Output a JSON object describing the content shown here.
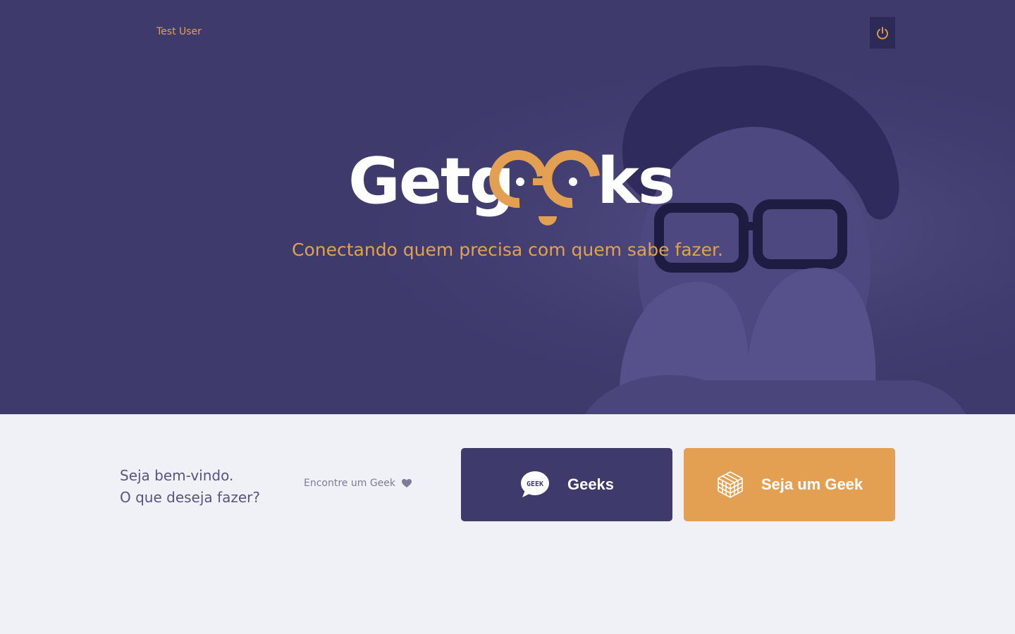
{
  "header": {
    "user_name": "Test User",
    "logout_icon": "power-icon"
  },
  "hero": {
    "logo_text_part1": "Getg",
    "logo_text_part2": "ks",
    "tagline": "Conectando quem precisa com quem sabe fazer."
  },
  "welcome": {
    "line1": "Seja bem-vindo.",
    "line2": "O que deseja fazer?"
  },
  "find_geek": {
    "label": "Encontre um Geek",
    "icon": "heart-icon"
  },
  "cards": {
    "geeks": {
      "label": "Geeks",
      "icon": "geek-speech-bubble-icon",
      "badge": "GEEK"
    },
    "seja": {
      "label": "Seja um Geek",
      "icon": "cube-icon"
    }
  },
  "colors": {
    "primary": "#3e3a6c",
    "accent": "#e4a052",
    "background": "#f0f0f7",
    "text_muted": "#5a5280"
  }
}
